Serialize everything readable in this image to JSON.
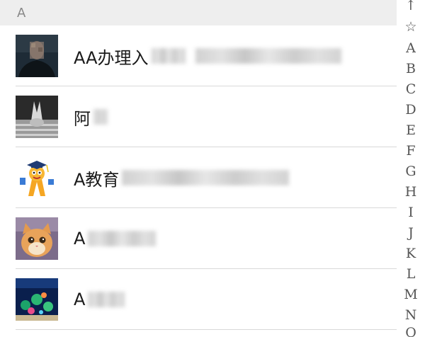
{
  "section": {
    "letter": "A"
  },
  "contacts": [
    {
      "name": "AA办理入",
      "avatar_icon": "person-photo-avatar"
    },
    {
      "name": "阿",
      "avatar_icon": "car-emblem-avatar"
    },
    {
      "name": "A教育",
      "avatar_icon": "cartoon-graduate-avatar"
    },
    {
      "name": "A",
      "avatar_icon": "cat-photo-avatar"
    },
    {
      "name": "A",
      "avatar_icon": "aquarium-photo-avatar"
    }
  ],
  "index": {
    "up": "↑",
    "star": "☆",
    "letters": [
      "A",
      "B",
      "C",
      "D",
      "E",
      "F",
      "G",
      "H",
      "I",
      "J",
      "K",
      "L",
      "M",
      "N",
      "O"
    ]
  }
}
